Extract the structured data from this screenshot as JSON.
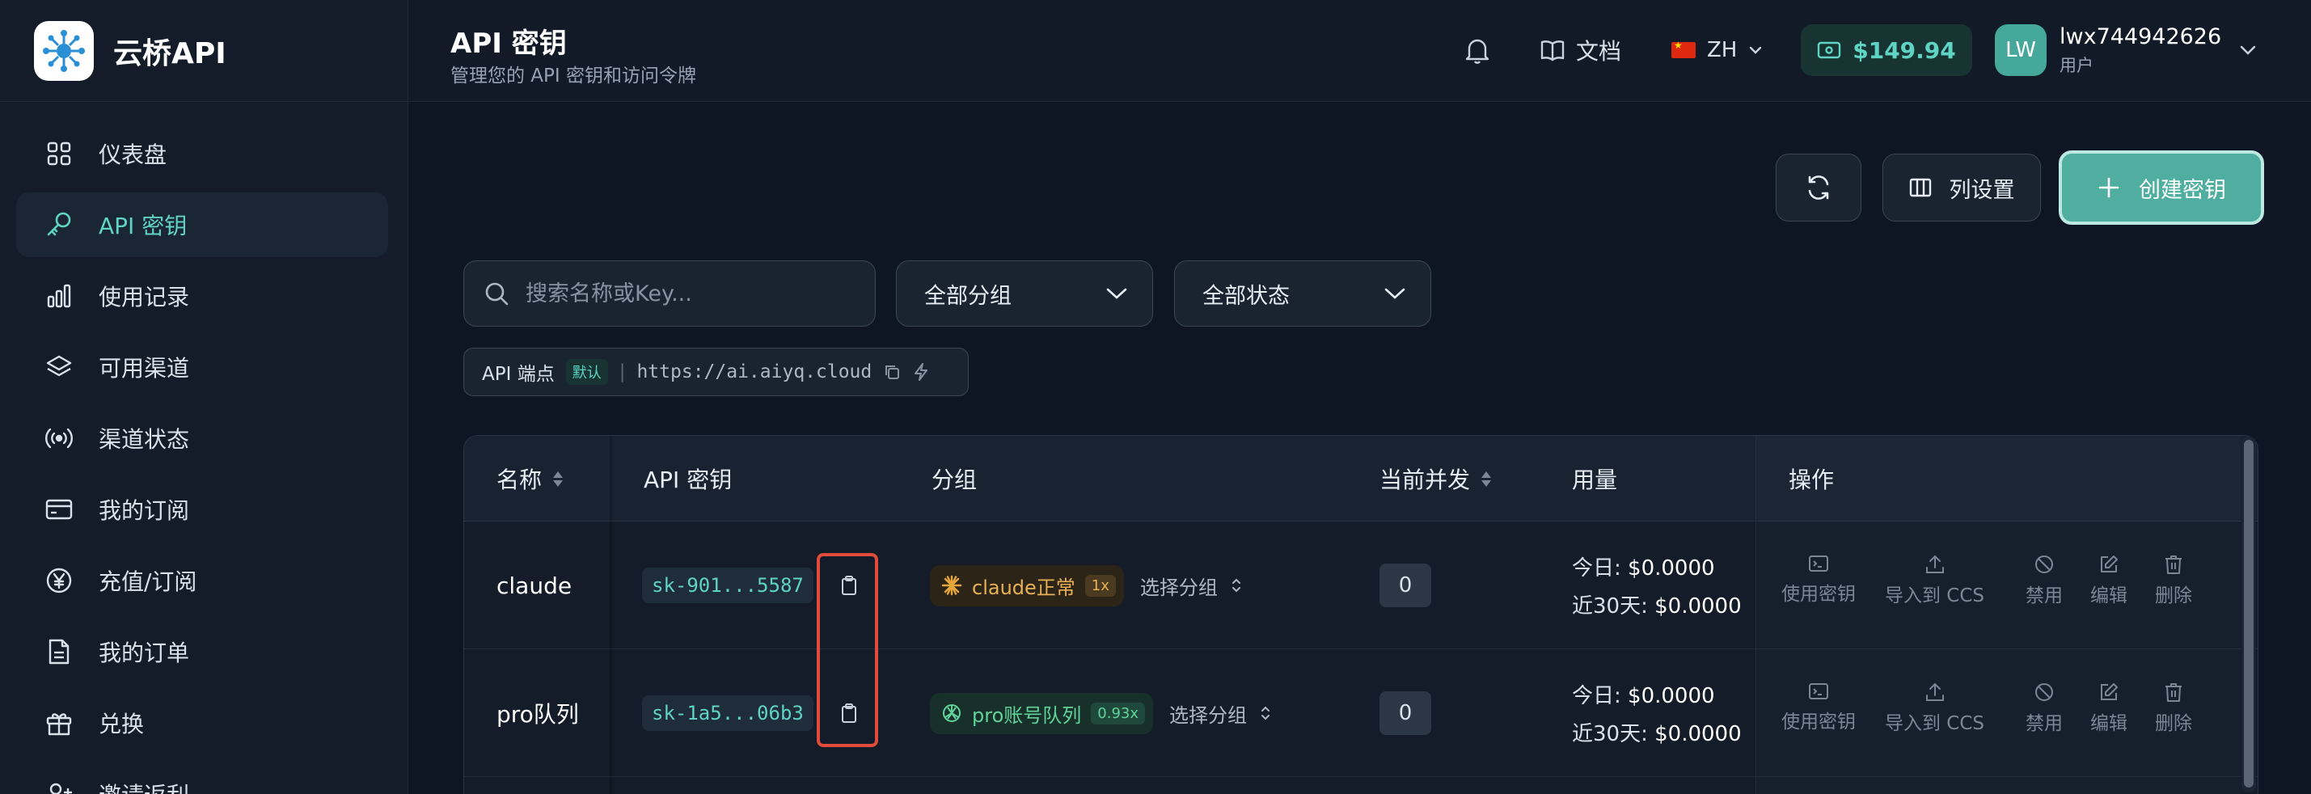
{
  "brand": {
    "name": "云桥API"
  },
  "sidebar": {
    "items": [
      {
        "label": "仪表盘",
        "icon": "dashboard-icon"
      },
      {
        "label": "API 密钥",
        "icon": "key-icon",
        "active": true
      },
      {
        "label": "使用记录",
        "icon": "bar-chart-icon"
      },
      {
        "label": "可用渠道",
        "icon": "layers-icon"
      },
      {
        "label": "渠道状态",
        "icon": "signal-icon"
      },
      {
        "label": "我的订阅",
        "icon": "credit-card-icon"
      },
      {
        "label": "充值/订阅",
        "icon": "yen-circle-icon"
      },
      {
        "label": "我的订单",
        "icon": "document-icon"
      },
      {
        "label": "兑换",
        "icon": "gift-icon"
      },
      {
        "label": "邀请返利",
        "icon": "user-plus-icon"
      }
    ]
  },
  "header": {
    "title": "API 密钥",
    "subtitle": "管理您的 API 密钥和访问令牌",
    "docs_label": "文档",
    "lang_label": "ZH",
    "balance": "$149.94",
    "user": {
      "initials": "LW",
      "name": "lwx744942626",
      "role": "用户"
    }
  },
  "toolbar": {
    "columns_label": "列设置",
    "create_label": "创建密钥"
  },
  "filters": {
    "search_placeholder": "搜索名称或Key...",
    "group_value": "全部分组",
    "status_value": "全部状态"
  },
  "endpoint": {
    "label": "API 端点",
    "badge": "默认",
    "separator": "|",
    "url": "https://ai.aiyq.cloud"
  },
  "table": {
    "columns": {
      "name": "名称",
      "key": "API 密钥",
      "group": "分组",
      "concurrency": "当前并发",
      "usage": "用量",
      "actions": "操作"
    },
    "action_labels": {
      "use": "使用密钥",
      "import": "导入到 CCS",
      "disable": "禁用",
      "edit": "编辑",
      "delete": "删除"
    },
    "rows": [
      {
        "name": "claude",
        "key": "sk-901...5587",
        "group": "claude正常",
        "multiplier": "1x",
        "group_select": "选择分组",
        "concurrency": "0",
        "today_label": "今日:",
        "today": "$0.0000",
        "month_label": "近30天:",
        "month": "$0.0000"
      },
      {
        "name": "pro队列",
        "key": "sk-1a5...06b3",
        "group": "pro账号队列",
        "multiplier": "0.93x",
        "group_select": "选择分组",
        "concurrency": "0",
        "today_label": "今日:",
        "today": "$0.0000",
        "month_label": "近30天:",
        "month": "$0.0000"
      }
    ]
  },
  "colors": {
    "accent": "#5fd4c4",
    "primary_button": "#4fae9f",
    "highlight": "#e14b3b",
    "background": "#0d1622"
  }
}
